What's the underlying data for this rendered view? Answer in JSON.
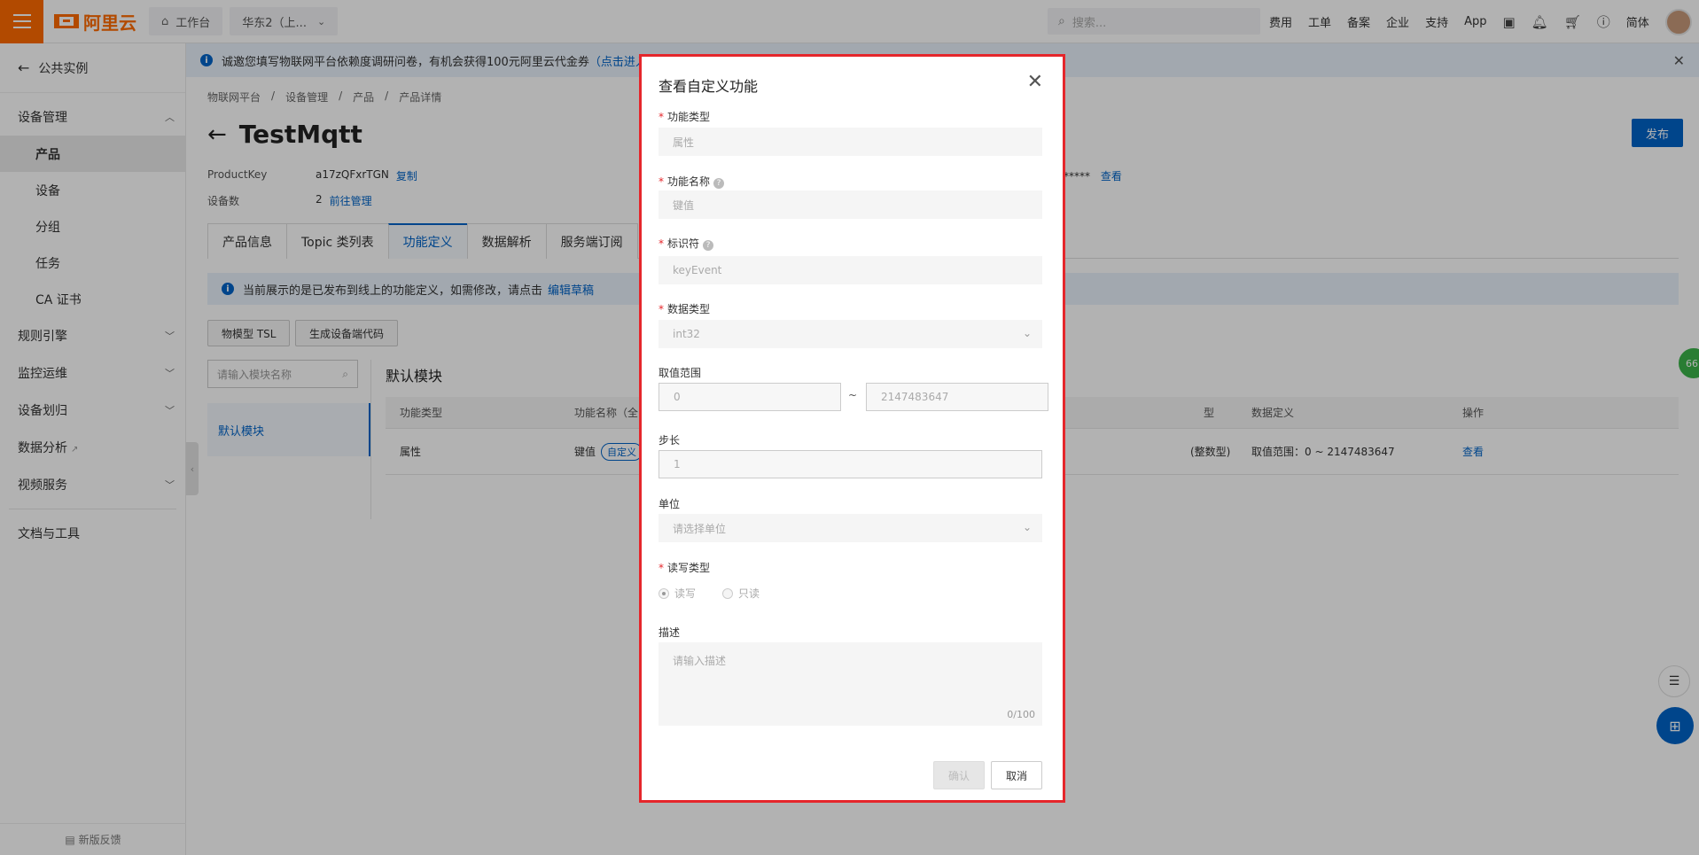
{
  "topbar": {
    "logo_text": "阿里云",
    "workbench": "工作台",
    "region": "华东2（上...",
    "search_placeholder": "搜索...",
    "links": [
      "费用",
      "工单",
      "备案",
      "企业",
      "支持",
      "App"
    ],
    "lang": "简体"
  },
  "sidebar": {
    "back": "公共实例",
    "group_device": "设备管理",
    "items": [
      "产品",
      "设备",
      "分组",
      "任务",
      "CA 证书"
    ],
    "groups": [
      "规则引擎",
      "监控运维",
      "设备划归",
      "数据分析",
      "视频服务"
    ],
    "docs": "文档与工具",
    "feedback": "新版反馈"
  },
  "notice": {
    "text": "诚邀您填写物联网平台依赖度调研问卷，有机会获得100元阿里云代金券",
    "link": "（点击进入）"
  },
  "breadcrumb": [
    "物联网平台",
    "设备管理",
    "产品",
    "产品详情"
  ],
  "product": {
    "title": "TestMqtt",
    "publish": "发布",
    "pk_label": "ProductKey",
    "pk_value": "a17zQFxrTGN",
    "copy": "复制",
    "devices_label": "设备数",
    "devices_value": "2",
    "manage": "前往管理",
    "secret_mask": "*****",
    "view": "查看"
  },
  "tabs": [
    "产品信息",
    "Topic 类列表",
    "功能定义",
    "数据解析",
    "服务端订阅"
  ],
  "hint": {
    "text": "当前展示的是已发布到线上的功能定义，如需修改，请点击",
    "link": "编辑草稿"
  },
  "buttons": {
    "tsl": "物模型 TSL",
    "gen_code": "生成设备端代码"
  },
  "module": {
    "search_placeholder": "请输入模块名称",
    "default": "默认模块",
    "title": "默认模块"
  },
  "table": {
    "headers": [
      "功能类型",
      "功能名称（全",
      "",
      "数据定义",
      "操作"
    ],
    "col3_header_tail": "型",
    "row": {
      "type": "属性",
      "name": "键值",
      "tag": "自定义",
      "datatype_tail": "(整数型)",
      "definition": "取值范围：0 ~ 2147483647",
      "action": "查看"
    }
  },
  "modal": {
    "title": "查看自定义功能",
    "type_label": "功能类型",
    "type_value": "属性",
    "name_label": "功能名称",
    "name_value": "键值",
    "id_label": "标识符",
    "id_value": "keyEvent",
    "datatype_label": "数据类型",
    "datatype_value": "int32",
    "range_label": "取值范围",
    "range_min": "0",
    "range_tilde": "~",
    "range_max": "2147483647",
    "step_label": "步长",
    "step_value": "1",
    "unit_label": "单位",
    "unit_placeholder": "请选择单位",
    "rw_label": "读写类型",
    "rw_options": [
      "读写",
      "只读"
    ],
    "rw_selected": "读写",
    "desc_label": "描述",
    "desc_placeholder": "请输入描述",
    "desc_count": "0/100",
    "ok": "确认",
    "cancel": "取消"
  },
  "float": {
    "badge": "66"
  }
}
